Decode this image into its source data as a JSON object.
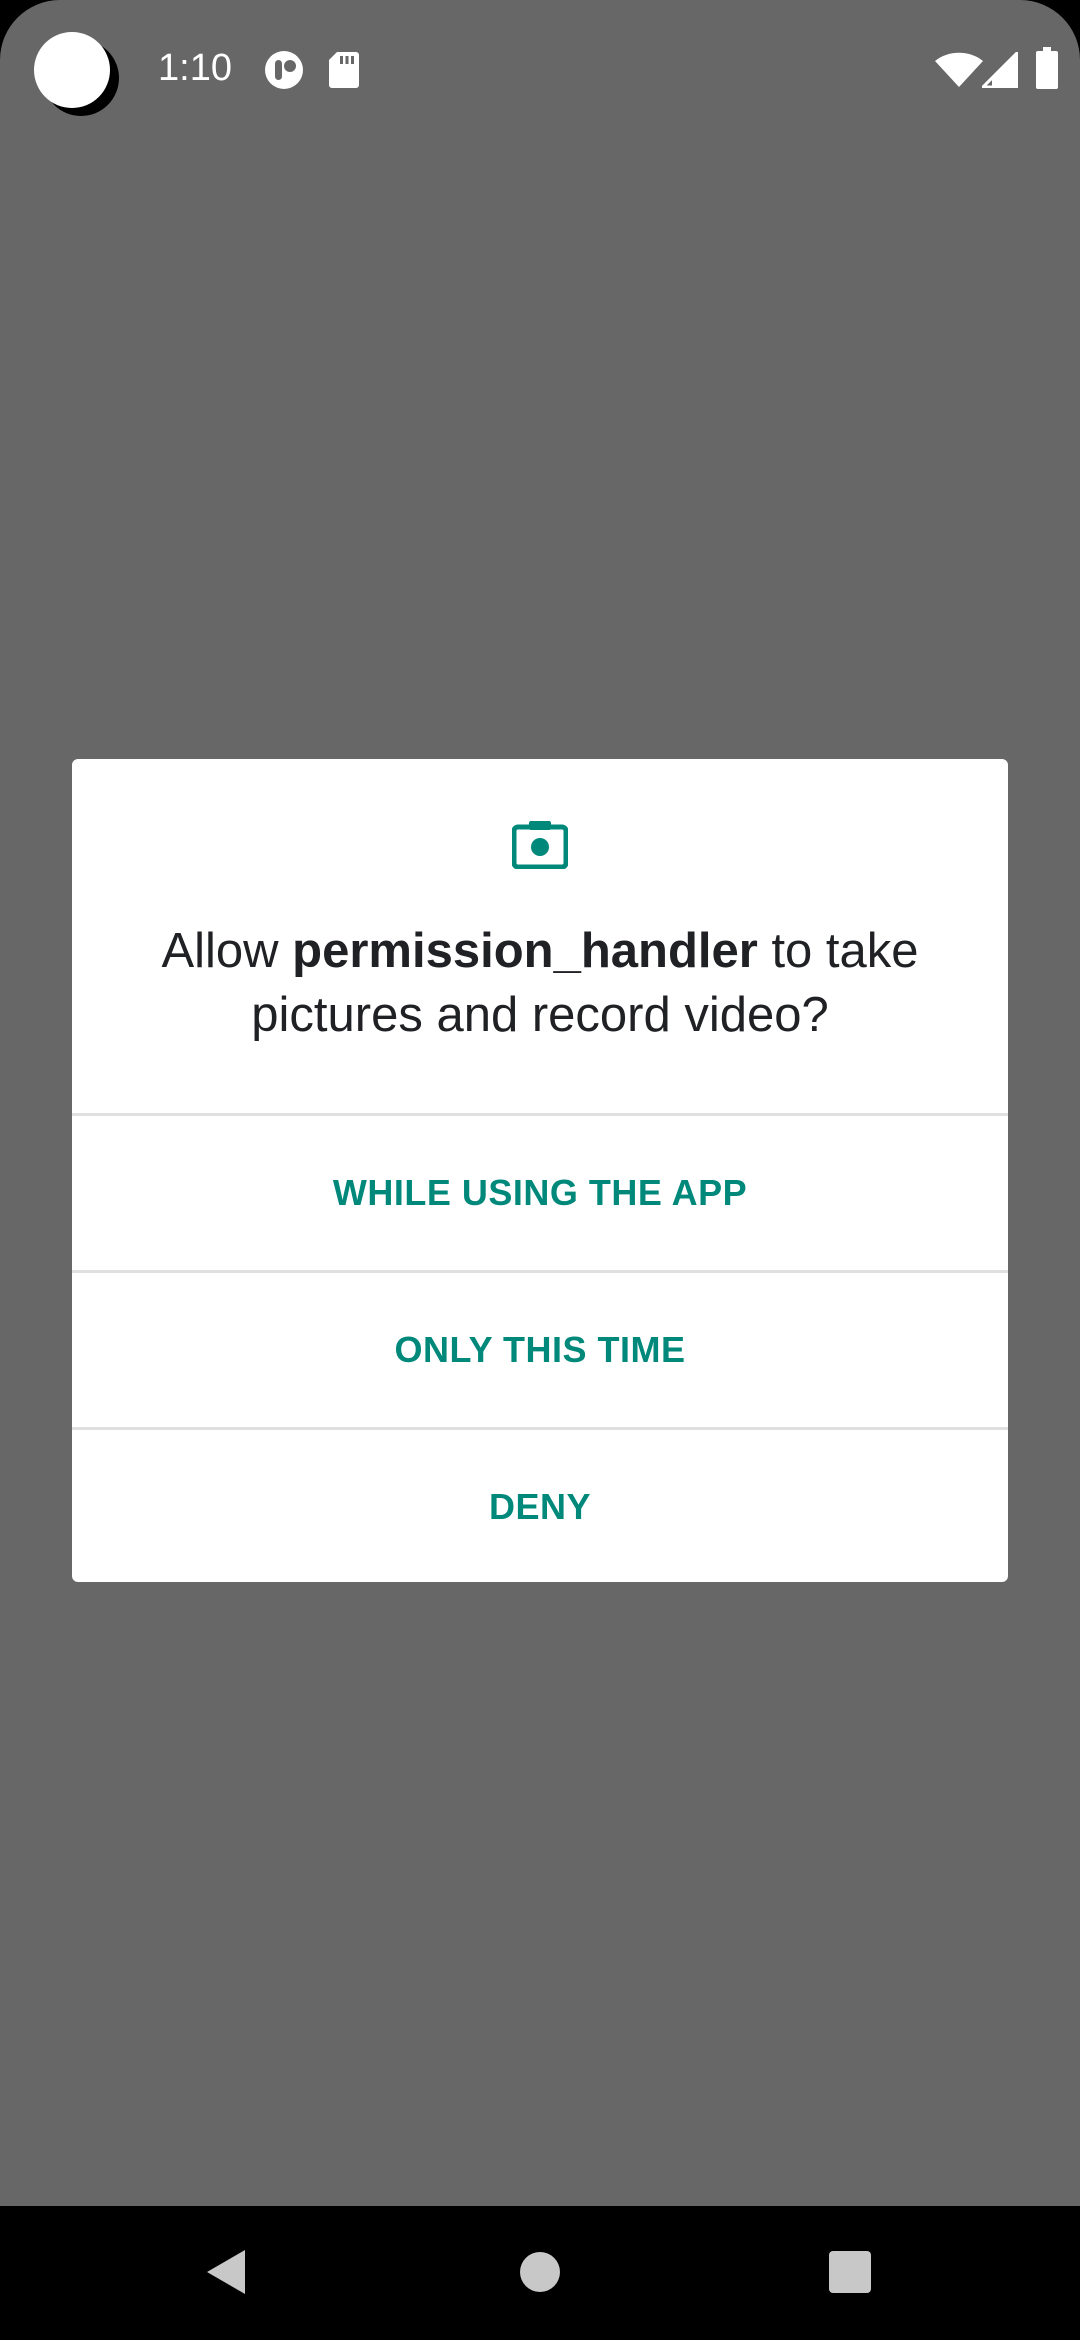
{
  "status_bar": {
    "time": "1:10",
    "left_icons": [
      "app-notification-icon",
      "sd-card-icon"
    ],
    "right_icons": [
      "wifi-icon",
      "cell-signal-icon",
      "battery-icon"
    ]
  },
  "dialog": {
    "icon": "camera-icon",
    "title_prefix": "Allow ",
    "app_name": "permission_handler",
    "title_suffix": " to take pictures and record video?",
    "options": [
      {
        "label": "WHILE USING THE APP"
      },
      {
        "label": "ONLY THIS TIME"
      },
      {
        "label": "DENY"
      }
    ]
  },
  "nav_bar": {
    "buttons": [
      "back-icon",
      "home-icon",
      "recents-icon"
    ]
  },
  "colors": {
    "scrim": "#676767",
    "accent": "#00897b",
    "dialog_bg": "#ffffff",
    "title_text": "#202124",
    "nav_bar_bg": "#000000"
  }
}
